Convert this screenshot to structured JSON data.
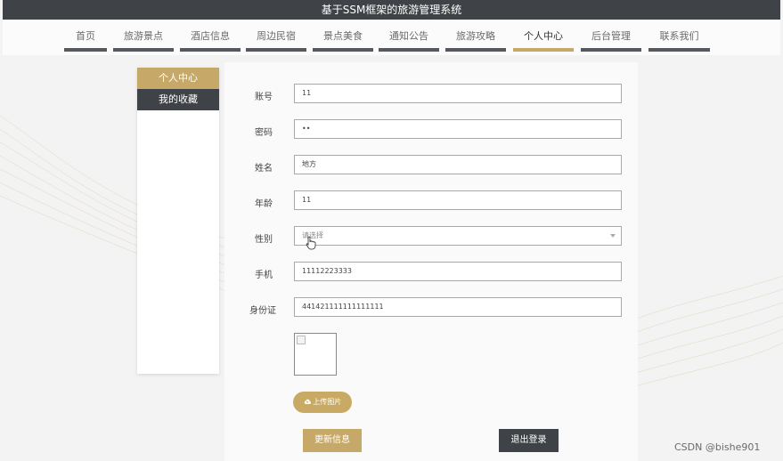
{
  "header": {
    "title": "基于SSM框架的旅游管理系统"
  },
  "nav": {
    "items": [
      {
        "label": "首页"
      },
      {
        "label": "旅游景点"
      },
      {
        "label": "酒店信息"
      },
      {
        "label": "周边民宿"
      },
      {
        "label": "景点美食"
      },
      {
        "label": "通知公告"
      },
      {
        "label": "旅游攻略"
      },
      {
        "label": "个人中心"
      },
      {
        "label": "后台管理"
      },
      {
        "label": "联系我们"
      }
    ],
    "active_label": "个人中心"
  },
  "sidebar": {
    "items": [
      {
        "label": "个人中心"
      },
      {
        "label": "我的收藏"
      }
    ]
  },
  "form": {
    "account": {
      "label": "账号",
      "value": "11"
    },
    "password": {
      "label": "密码",
      "value": "••"
    },
    "name": {
      "label": "姓名",
      "value": "地方"
    },
    "age": {
      "label": "年龄",
      "value": "11"
    },
    "gender": {
      "label": "性别",
      "placeholder": "请选择"
    },
    "phone": {
      "label": "手机",
      "value": "11112223333"
    },
    "id_card": {
      "label": "身份证",
      "value": "441421111111111111"
    },
    "upload_label": "上传图片"
  },
  "actions": {
    "update_label": "更新信息",
    "logout_label": "退出登录"
  },
  "watermark": "CSDN @bishe901",
  "colors": {
    "accent": "#c6a968",
    "dark": "#3f4246"
  }
}
